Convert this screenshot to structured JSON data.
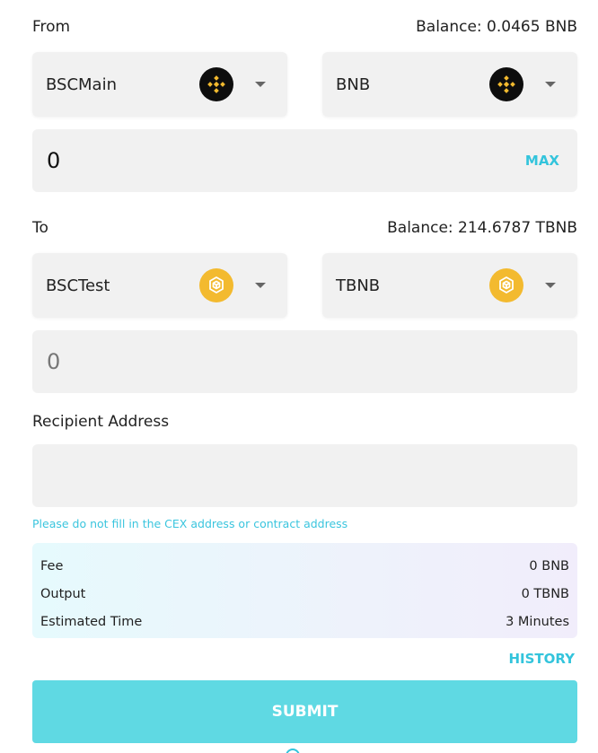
{
  "from": {
    "label": "From",
    "balance": "Balance: 0.0465 BNB",
    "network": {
      "name": "BSCMain",
      "icon": "bnb-black-icon"
    },
    "token": {
      "name": "BNB",
      "icon": "bnb-black-icon"
    },
    "amount": "0",
    "max_label": "MAX"
  },
  "to": {
    "label": "To",
    "balance": "Balance: 214.6787 TBNB",
    "network": {
      "name": "BSCTest",
      "icon": "bnb-gold-icon"
    },
    "token": {
      "name": "TBNB",
      "icon": "bnb-gold-icon"
    },
    "amount": "0"
  },
  "recipient": {
    "label": "Recipient Address",
    "value": "",
    "hint": "Please do not fill in the CEX address or contract address"
  },
  "summary": {
    "fee_label": "Fee",
    "fee_value": "0 BNB",
    "output_label": "Output",
    "output_value": "0 TBNB",
    "time_label": "Estimated Time",
    "time_value": "3 Minutes"
  },
  "history_label": "HISTORY",
  "submit_label": "SUBMIT",
  "colors": {
    "accent": "#33c4dc",
    "submit_bg": "#5fd9e3",
    "field_bg": "#f1f1f1",
    "bnb_gold": "#f3ba2f",
    "bnb_black": "#0d0d0d"
  }
}
